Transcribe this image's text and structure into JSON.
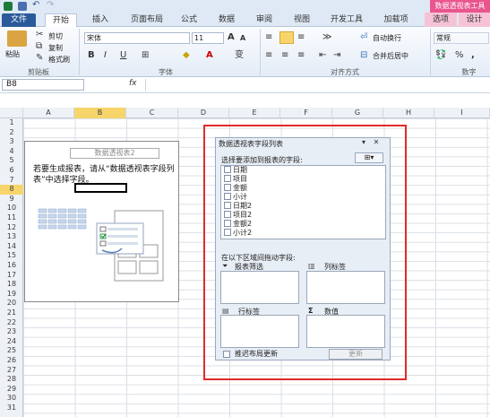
{
  "context_title": "数据透视表工具",
  "tabs": [
    "文件",
    "开始",
    "插入",
    "页面布局",
    "公式",
    "数据",
    "审阅",
    "视图",
    "开发工具",
    "加载项",
    "选项",
    "设计"
  ],
  "clipboard": {
    "paste": "粘贴",
    "cut": "剪切",
    "copy": "复制",
    "format_painter": "格式刷",
    "label": "剪贴板"
  },
  "font": {
    "name": "宋体",
    "size": "11",
    "label": "字体"
  },
  "alignment": {
    "wrap": "自动换行",
    "merge": "合并后居中",
    "label": "对齐方式"
  },
  "number": {
    "format": "常规",
    "label": "数字"
  },
  "formula_bar": {
    "namebox": "B8",
    "fx": "fx",
    "value": ""
  },
  "columns": [
    "A",
    "B",
    "C",
    "D",
    "E",
    "F",
    "G",
    "H",
    "I"
  ],
  "rows": [
    "1",
    "2",
    "3",
    "4",
    "5",
    "6",
    "7",
    "8",
    "9",
    "10",
    "11",
    "12",
    "13",
    "14",
    "15",
    "16",
    "17",
    "18",
    "19",
    "20",
    "21",
    "22",
    "23",
    "24",
    "25",
    "26",
    "27",
    "28",
    "29",
    "30",
    "31"
  ],
  "pivot_placeholder": {
    "title": "数据透视表2",
    "message": "若要生成报表，请从“数据透视表字段列表”中选择字段。"
  },
  "field_list_panel": {
    "title": "数据透视表字段列表",
    "choose_label": "选择要添加到报表的字段:",
    "fields": [
      "日期",
      "项目",
      "金额",
      "小计",
      "日期2",
      "项目2",
      "金额2",
      "小计2"
    ],
    "drag_label": "在以下区域间拖动字段:",
    "zones": {
      "report_filter": "报表筛选",
      "column_labels": "列标签",
      "row_labels": "行标签",
      "values": "数值"
    },
    "defer_label": "推迟布局更新",
    "update_button": "更新"
  }
}
